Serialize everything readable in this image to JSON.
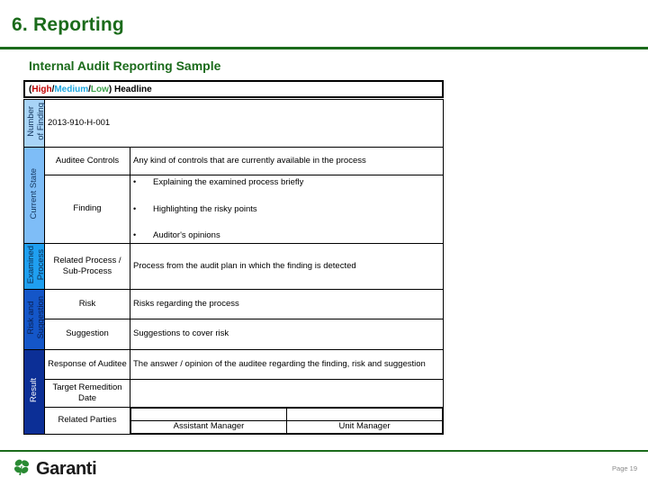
{
  "slide": {
    "title": "6. Reporting",
    "section_heading": "Internal Audit Reporting Sample",
    "page_label": "Page 19"
  },
  "headline": {
    "open_paren": "(",
    "high": "High",
    "sep1": " / ",
    "medium": "Medium",
    "sep2": " / ",
    "low": "Low",
    "close_paren": ") Headline",
    "colors": {
      "high": "#c00000",
      "medium": "#1fa8e0",
      "low": "#3fa34d"
    }
  },
  "bands": [
    {
      "key": "number",
      "label": "Number\nof Finding",
      "bg": "#a8d4f7",
      "fg": "#14365e"
    },
    {
      "key": "current",
      "label": "Current State",
      "bg": "#7ebdf7",
      "fg": "#14365e"
    },
    {
      "key": "examined",
      "label": "Examined\nProcess",
      "bg": "#1f9ff0",
      "fg": "#0d2c50"
    },
    {
      "key": "risk",
      "label": "Risk and\nSuggestion",
      "bg": "#1456c8",
      "fg": "#0a1f50"
    },
    {
      "key": "result",
      "label": "Result",
      "bg": "#0c2f96",
      "fg": "#ffffff"
    }
  ],
  "rows": {
    "finding_number_value": "2013-910-H-001",
    "auditee_controls_label": "Auditee Controls",
    "auditee_controls_value": "Any kind of controls that are currently available in the process",
    "finding_label": "Finding",
    "finding_bullets": [
      "Explaining the examined process briefly",
      "Highlighting the risky points",
      "Auditor's opinions"
    ],
    "bullet_glyph": "•",
    "related_process_label": "Related Process / Sub-Process",
    "related_process_value": "Process from the audit plan in which the finding is detected",
    "risk_label": "Risk",
    "risk_value": "Risks regarding the process",
    "suggestion_label": "Suggestion",
    "suggestion_value": "Suggestions to cover risk",
    "response_label": "Response of Auditee",
    "response_value": "The answer / opinion of the auditee regarding the finding, risk and suggestion",
    "target_date_label": "Target Remedition Date",
    "target_date_value": "",
    "related_parties_label": "Related Parties",
    "signature_1": "Assistant Manager",
    "signature_2": "Unit Manager"
  },
  "brand": {
    "name": "Garanti",
    "logo_color": "#2a8a33",
    "icon": "clover-icon"
  },
  "theme": {
    "green": "#1b6b1b"
  }
}
